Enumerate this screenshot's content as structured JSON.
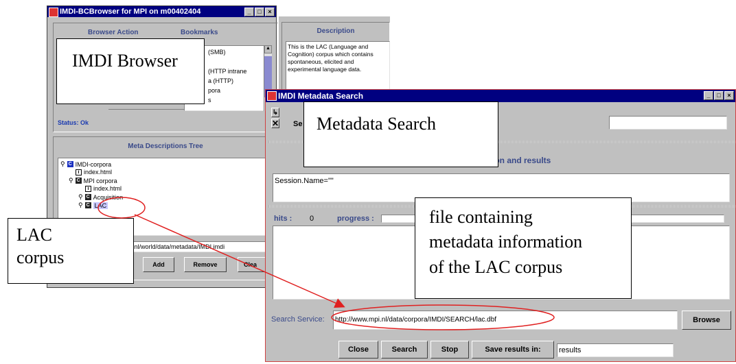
{
  "browser": {
    "title": "IMDI-BCBrowser for MPI on m00402404",
    "browser_action": "Browser Action",
    "bookmarks": "Bookmarks",
    "bookmark_items": [
      "(SMB)",
      "(HTTP intrane",
      "a (HTTP)",
      "pora",
      "s"
    ],
    "description_header": "Description",
    "description_text": "This is the LAC (Language and Cognition) corpus which contains spontaneous, elicited and experimental language data.",
    "status": "Status: Ok",
    "tree_header": "Meta Descriptions Tree",
    "tree": [
      {
        "label": "IMDI-corpora",
        "icon": "C"
      },
      {
        "label": "index.html",
        "icon": "i"
      },
      {
        "label": "MPI corpora",
        "icon": "C"
      },
      {
        "label": "index.html",
        "icon": "i"
      },
      {
        "label": "Acquisition",
        "icon": "C"
      },
      {
        "label": "LAC",
        "icon": "C"
      }
    ],
    "url": "npi.nl/world/data/metadata/IMDI.imdi",
    "add": "Add",
    "remove": "Remove",
    "clear": "Clea"
  },
  "search": {
    "title": "IMDI Metadata Search",
    "search_tab_partial": "Se",
    "section_header": "tion and results",
    "query": "Session.Name=\"\"",
    "hits_label": "hits :",
    "hits_value": "0",
    "progress_label": "progress :",
    "service_label": "Search Service:",
    "service_value": "http://www.mpi.nl/data/corpora/IMDI/SEARCH/lac.dbf",
    "browse": "Browse",
    "close": "Close",
    "search": "Search",
    "stop": "Stop",
    "save_results": "Save results in:",
    "results_value": "results"
  },
  "annotations": {
    "imdi_browser": "IMDI Browser",
    "metadata_search": "Metadata Search",
    "lac_corpus_1": "LAC",
    "lac_corpus_2": "corpus",
    "file_info_1": "file containing",
    "file_info_2": "metadata information",
    "file_info_3": "of the LAC corpus"
  },
  "colors": {
    "title_bar": "#000080",
    "header_text": "#3a4a8a",
    "annotation_red": "#e02020"
  }
}
